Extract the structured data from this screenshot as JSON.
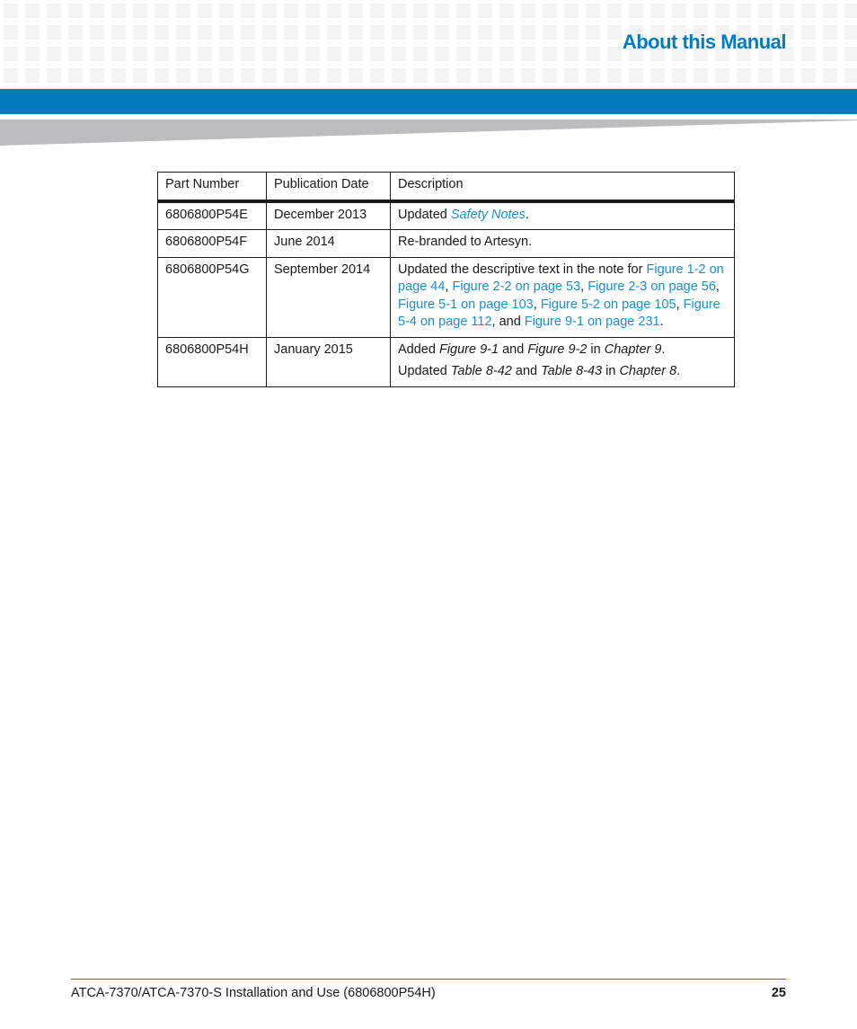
{
  "header": {
    "title": "About this Manual",
    "accent_color": "#037cbe"
  },
  "table": {
    "columns": [
      "Part Number",
      "Publication Date",
      "Description"
    ],
    "rows": [
      {
        "part_number": "6806800P54E",
        "date": "December 2013",
        "description": [
          [
            {
              "text": "Updated ",
              "style": "plain"
            },
            {
              "text": "Safety Notes",
              "style": "link-italic"
            },
            {
              "text": ".",
              "style": "plain"
            }
          ]
        ]
      },
      {
        "part_number": "6806800P54F",
        "date": "June 2014",
        "description": [
          [
            {
              "text": "Re-branded to Artesyn.",
              "style": "plain"
            }
          ]
        ]
      },
      {
        "part_number": "6806800P54G",
        "date": "September 2014",
        "description": [
          [
            {
              "text": "Updated the descriptive text in the note for ",
              "style": "plain"
            },
            {
              "text": "Figure 1-2 on page 44",
              "style": "link"
            },
            {
              "text": ", ",
              "style": "plain"
            },
            {
              "text": "Figure 2-2 on page 53",
              "style": "link"
            },
            {
              "text": ", ",
              "style": "plain"
            },
            {
              "text": "Figure 2-3 on page 56",
              "style": "link"
            },
            {
              "text": ", ",
              "style": "plain"
            },
            {
              "text": "Figure 5-1 on page 103",
              "style": "link"
            },
            {
              "text": ", ",
              "style": "plain"
            },
            {
              "text": "Figure 5-2 on page 105",
              "style": "link"
            },
            {
              "text": ", ",
              "style": "plain"
            },
            {
              "text": "Figure 5-4 on page 112",
              "style": "link"
            },
            {
              "text": ", and ",
              "style": "plain"
            },
            {
              "text": "Figure 9-1 on page 231",
              "style": "link"
            },
            {
              "text": ".",
              "style": "plain"
            }
          ]
        ]
      },
      {
        "part_number": "6806800P54H",
        "date": "January 2015",
        "description": [
          [
            {
              "text": "Added ",
              "style": "plain"
            },
            {
              "text": "Figure 9-1",
              "style": "italic"
            },
            {
              "text": " and ",
              "style": "plain"
            },
            {
              "text": "Figure 9-2",
              "style": "italic"
            },
            {
              "text": " in ",
              "style": "plain"
            },
            {
              "text": "Chapter 9",
              "style": "italic"
            },
            {
              "text": ".",
              "style": "plain"
            }
          ],
          [
            {
              "text": "Updated ",
              "style": "plain"
            },
            {
              "text": "Table 8-42",
              "style": "italic"
            },
            {
              "text": " and ",
              "style": "plain"
            },
            {
              "text": "Table 8-43",
              "style": "italic"
            },
            {
              "text": " in ",
              "style": "plain"
            },
            {
              "text": "Chapter 8",
              "style": "italic"
            },
            {
              "text": ".",
              "style": "plain"
            }
          ]
        ]
      }
    ]
  },
  "footer": {
    "document_title": "ATCA-7370/ATCA-7370-S Installation and Use (6806800P54H)",
    "page_number": "25"
  }
}
